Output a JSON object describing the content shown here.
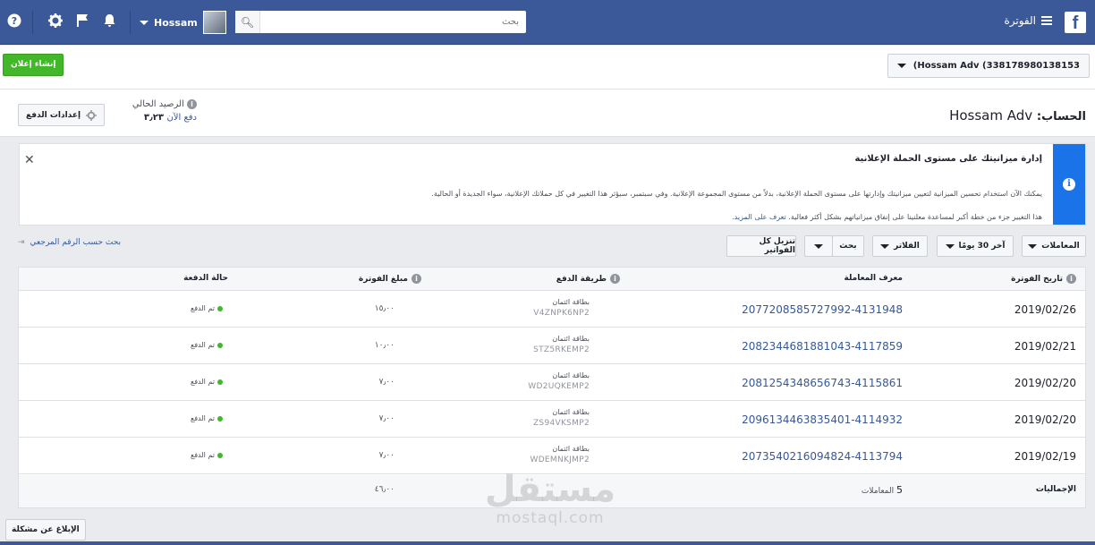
{
  "topbar": {
    "logo": "f",
    "menu_label": "الفوترة",
    "search_placeholder": "بحث",
    "user_name": "Hossam",
    "icons": [
      "search-icon",
      "bell-icon",
      "flag-icon",
      "gear-icon",
      "help-icon",
      "chevron-down-icon"
    ]
  },
  "header": {
    "create_ad_label": "إنشاء إعلان",
    "account_select": "(Hossam Adv (338178980138153",
    "account_label": "الحساب:",
    "account_name": "Hossam Adv",
    "balance_label": "الرصيد الحالي",
    "balance_amount": "٣٫٢٣",
    "pay_now": "دفع الآن",
    "payment_settings_label": "إعدادات الدفع"
  },
  "banner": {
    "title": "إدارة ميزانيتك على مستوى الحملة الإعلانية",
    "p1": "يمكنك الآن استخدام تحسين الميزانية لتعيين ميزانيتك وإدارتها على مستوى الحملة الإعلانية، بدلاً من مستوى المجموعة الإعلانية. وفي سبتمبر، سيؤثر هذا التغيير في كل حملاتك الإعلانية، سواء الجديدة أو الحالية.",
    "p2": "هذا التغيير جزء من خطة أكبر لمساعدة معلنينا على إنفاق ميزانياتهم بشكل أكثر فعالية.",
    "learn_more": "تعرف على المزيد."
  },
  "toolbar": {
    "search_ref": "بحث حسب الرقم المرجعي",
    "transactions": "المعاملات",
    "last30": "آخر 30 يومًا",
    "filters": "الفلاتر",
    "search": "بحث",
    "download_all": "تنزيل كل الفواتير"
  },
  "table": {
    "headers": {
      "date": "تاريخ الفوترة",
      "txn": "معرف المعاملة",
      "method": "طريقة الدفع",
      "amount": "مبلغ الفوترة",
      "status": "حالة الدفعة"
    },
    "rows": [
      {
        "date": "2019/02/26",
        "txn": "2077208585727992-4131948",
        "method": "بطاقة ائتمان",
        "code": "V4ZNPK6NP2",
        "amount": "١٥٫٠٠",
        "status": "تم الدفع"
      },
      {
        "date": "2019/02/21",
        "txn": "2082344681881043-4117859",
        "method": "بطاقة ائتمان",
        "code": "STZ5RKEMP2",
        "amount": "١٠٫٠٠",
        "status": "تم الدفع"
      },
      {
        "date": "2019/02/20",
        "txn": "2081254348656743-4115861",
        "method": "بطاقة ائتمان",
        "code": "WD2UQKEMP2",
        "amount": "٧٫٠٠",
        "status": "تم الدفع"
      },
      {
        "date": "2019/02/20",
        "txn": "2096134463835401-4114932",
        "method": "بطاقة ائتمان",
        "code": "ZS94VKSMP2",
        "amount": "٧٫٠٠",
        "status": "تم الدفع"
      },
      {
        "date": "2019/02/19",
        "txn": "2073540216094824-4113794",
        "method": "بطاقة ائتمان",
        "code": "WDEMNKJMP2",
        "amount": "٧٫٠٠",
        "status": "تم الدفع"
      }
    ],
    "totals_label": "الإجماليات",
    "totals_count": "5",
    "totals_count_label": "المعاملات",
    "totals_amount": "٤٦٫٠٠"
  },
  "footer": {
    "report_label": "الإبلاغ عن مشكلة"
  },
  "watermark": {
    "arabic": "مستقل",
    "latin": "mostaql.com"
  },
  "colors": {
    "brand": "#3b5998",
    "green": "#42b72a",
    "link": "#365899",
    "info": "#1a73e8"
  }
}
